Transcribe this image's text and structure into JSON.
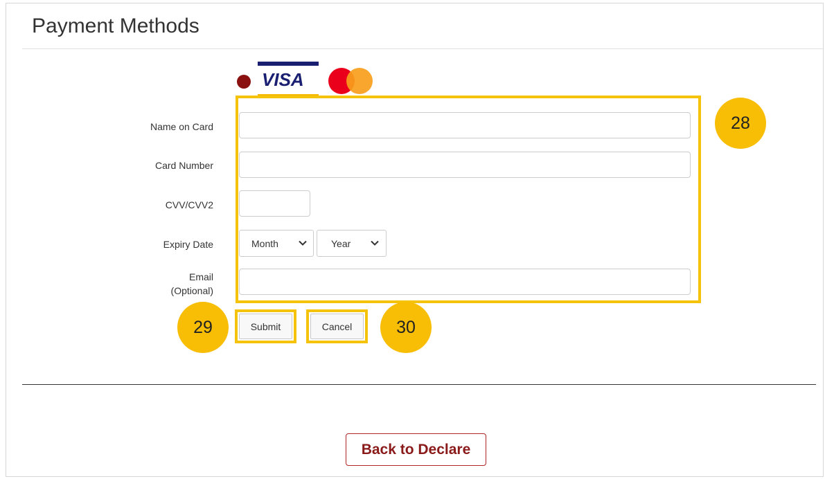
{
  "header": {
    "title": "Payment Methods"
  },
  "card_types": [
    {
      "name": "dot-icon",
      "color": "#8b1010"
    },
    {
      "name": "visa-icon",
      "label": "VISA",
      "selected": true
    },
    {
      "name": "mastercard-icon"
    }
  ],
  "form": {
    "name_on_card": {
      "label": "Name on Card",
      "value": ""
    },
    "card_number": {
      "label": "Card Number",
      "value": ""
    },
    "cvv": {
      "label": "CVV/CVV2",
      "value": ""
    },
    "expiry": {
      "label": "Expiry Date",
      "month": "Month",
      "year": "Year"
    },
    "email": {
      "label_line1": "Email",
      "label_line2": "(Optional)",
      "value": ""
    }
  },
  "buttons": {
    "submit": "Submit",
    "cancel": "Cancel",
    "back": "Back to Declare"
  },
  "annotations": {
    "form_box": "28",
    "submit": "29",
    "cancel": "30"
  },
  "colors": {
    "highlight": "#f5c20c",
    "badge": "#f8bd05",
    "back_button": "#8b1a1a"
  }
}
